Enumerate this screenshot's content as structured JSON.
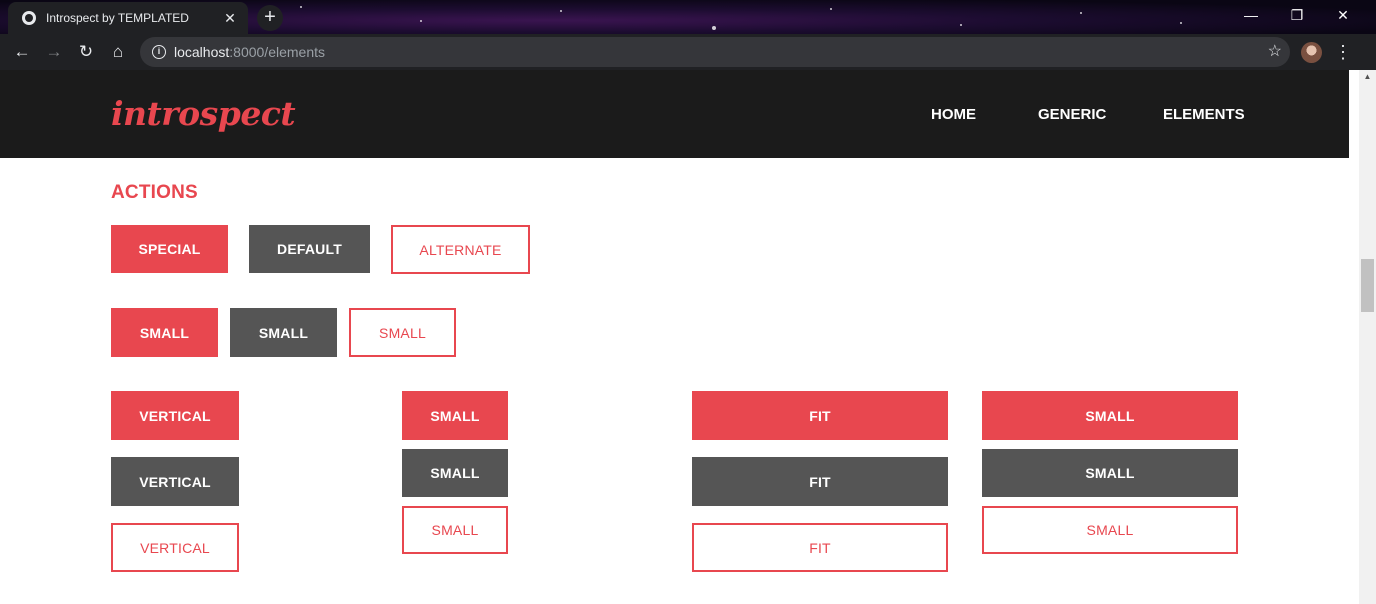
{
  "browser": {
    "tab_title": "Introspect by TEMPLATED",
    "tab_close": "✕",
    "new_tab": "+",
    "url_host": "localhost",
    "url_path": ":8000/elements",
    "window_controls": {
      "minimize": "—",
      "restore": "❐",
      "close": "✕"
    }
  },
  "site": {
    "logo": "introspect",
    "nav": [
      "HOME",
      "GENERIC",
      "ELEMENTS"
    ]
  },
  "section": {
    "title": "ACTIONS"
  },
  "buttons": {
    "row1": [
      "SPECIAL",
      "DEFAULT",
      "ALTERNATE"
    ],
    "row2": [
      "SMALL",
      "SMALL",
      "SMALL"
    ],
    "col_vertical": [
      "VERTICAL",
      "VERTICAL",
      "VERTICAL"
    ],
    "col_small": [
      "SMALL",
      "SMALL",
      "SMALL"
    ],
    "col_fit": [
      "FIT",
      "FIT",
      "FIT"
    ],
    "col_fit_small": [
      "SMALL",
      "SMALL",
      "SMALL"
    ]
  },
  "colors": {
    "accent": "#e8474f",
    "default_button": "#555555",
    "header_bg": "#1b1b1b"
  }
}
